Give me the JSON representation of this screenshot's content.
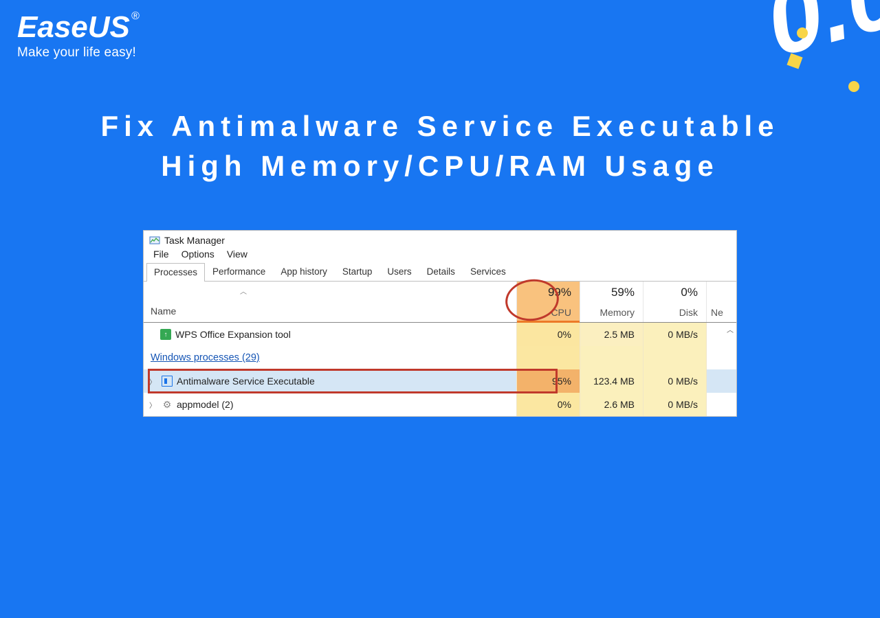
{
  "brand": {
    "name": "EaseUS",
    "registered": "®",
    "tagline": "Make your life easy!"
  },
  "title": {
    "line1": "Fix Antimalware Service Executable",
    "line2": "High Memory/CPU/RAM Usage"
  },
  "task_manager": {
    "window_title": "Task Manager",
    "menu": {
      "file": "File",
      "options": "Options",
      "view": "View"
    },
    "tabs": [
      "Processes",
      "Performance",
      "App history",
      "Startup",
      "Users",
      "Details",
      "Services"
    ],
    "active_tab": "Processes",
    "columns": {
      "name": "Name",
      "cpu": {
        "pct": "99%",
        "label": "CPU"
      },
      "memory": {
        "pct": "59%",
        "label": "Memory"
      },
      "disk": {
        "pct": "0%",
        "label": "Disk"
      },
      "net": {
        "label": "Ne"
      }
    },
    "group": "Windows processes (29)",
    "rows": [
      {
        "name": "WPS Office Expansion tool",
        "cpu": "0%",
        "mem": "2.5 MB",
        "disk": "0 MB/s"
      },
      {
        "name": "Antimalware Service Executable",
        "cpu": "95%",
        "mem": "123.4 MB",
        "disk": "0 MB/s"
      },
      {
        "name": "appmodel (2)",
        "cpu": "0%",
        "mem": "2.6 MB",
        "disk": "0 MB/s"
      }
    ]
  }
}
